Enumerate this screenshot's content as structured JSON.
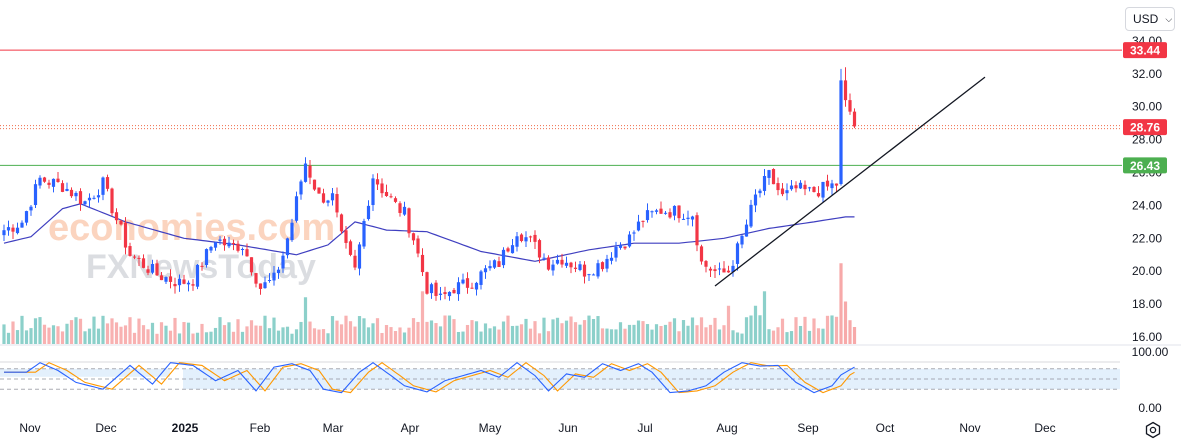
{
  "toolbar": {
    "currency": "USD"
  },
  "colors": {
    "up": "#2962ff",
    "down": "#f23645",
    "ma": "#3f3fc0",
    "resistance": "#f23645",
    "current": "#ef6c4a",
    "support": "#4caf50",
    "stoch_k": "#2962ff",
    "stoch_d": "#ff9800",
    "vol_up": "#80cbc4",
    "vol_down": "#f7a9a9",
    "band": "#e3f0fc"
  },
  "watermark": {
    "line1": "economies.com",
    "line2": "FXNewsToday"
  },
  "chart_data": {
    "type": "candlestick",
    "x_axis": {
      "labels": [
        "Nov",
        "Dec",
        "2025",
        "Feb",
        "Mar",
        "Apr",
        "May",
        "Jun",
        "Jul",
        "Aug",
        "Sep",
        "Oct",
        "Nov",
        "Dec"
      ]
    },
    "y_axis": {
      "ticks": [
        "34.00",
        "32.00",
        "30.00",
        "28.00",
        "26.00",
        "24.00",
        "22.00",
        "20.00",
        "18.00",
        "16.00"
      ],
      "range": [
        15.5,
        34.5
      ]
    },
    "price_levels": [
      {
        "name": "resistance",
        "value": 33.44,
        "label": "33.44",
        "style": "solid"
      },
      {
        "name": "current",
        "value": 28.76,
        "label": "28.76",
        "style": "dotted"
      },
      {
        "name": "support",
        "value": 26.43,
        "label": "26.43",
        "style": "solid"
      }
    ],
    "moving_average_anchors": [
      [
        0,
        21.7
      ],
      [
        6,
        22.1
      ],
      [
        13,
        23.8
      ],
      [
        17,
        24.1
      ],
      [
        27,
        23.0
      ],
      [
        40,
        22.0
      ],
      [
        52,
        21.6
      ],
      [
        65,
        21.0
      ],
      [
        72,
        21.6
      ],
      [
        78,
        23.0
      ],
      [
        85,
        22.5
      ],
      [
        94,
        22.4
      ],
      [
        106,
        21.2
      ],
      [
        118,
        20.6
      ],
      [
        130,
        21.3
      ],
      [
        140,
        21.7
      ],
      [
        150,
        21.7
      ],
      [
        160,
        22.0
      ],
      [
        170,
        22.6
      ],
      [
        180,
        23.0
      ],
      [
        187,
        23.3
      ]
    ],
    "price_anchors": [
      [
        0,
        22.5
      ],
      [
        4,
        23.0
      ],
      [
        8,
        25.6
      ],
      [
        13,
        25.2
      ],
      [
        18,
        24.2
      ],
      [
        22,
        25.3
      ],
      [
        28,
        21.0
      ],
      [
        34,
        19.8
      ],
      [
        39,
        19.3
      ],
      [
        42,
        19.5
      ],
      [
        47,
        22.0
      ],
      [
        50,
        21.5
      ],
      [
        53,
        21.6
      ],
      [
        57,
        19.0
      ],
      [
        60,
        19.5
      ],
      [
        62,
        21.0
      ],
      [
        64,
        23.0
      ],
      [
        66,
        25.5
      ],
      [
        67,
        26.6
      ],
      [
        70,
        24.5
      ],
      [
        73,
        24.5
      ],
      [
        75,
        22.0
      ],
      [
        78,
        20.0
      ],
      [
        80,
        23.0
      ],
      [
        82,
        25.8
      ],
      [
        84,
        25.0
      ],
      [
        87,
        24.0
      ],
      [
        89,
        23.5
      ],
      [
        91,
        22.0
      ],
      [
        94,
        19.0
      ],
      [
        97,
        18.3
      ],
      [
        100,
        19.0
      ],
      [
        103,
        19.2
      ],
      [
        107,
        20.0
      ],
      [
        110,
        20.5
      ],
      [
        114,
        22.5
      ],
      [
        117,
        21.8
      ],
      [
        121,
        20.5
      ],
      [
        124,
        20.8
      ],
      [
        129,
        20.0
      ],
      [
        133,
        20.5
      ],
      [
        136,
        21.5
      ],
      [
        139,
        22.0
      ],
      [
        142,
        23.2
      ],
      [
        146,
        23.7
      ],
      [
        150,
        23.6
      ],
      [
        153,
        23.5
      ],
      [
        155,
        20.5
      ],
      [
        159,
        19.8
      ],
      [
        161,
        20.0
      ],
      [
        164,
        22.0
      ],
      [
        167,
        24.5
      ],
      [
        170,
        25.8
      ],
      [
        173,
        24.5
      ],
      [
        176,
        25.0
      ],
      [
        179,
        24.8
      ],
      [
        182,
        25.0
      ],
      [
        185,
        25.3
      ]
    ],
    "candles_end": [
      {
        "i": 186,
        "o": 25.3,
        "h": 32.3,
        "l": 25.2,
        "c": 31.6
      },
      {
        "i": 187,
        "o": 31.6,
        "h": 32.4,
        "l": 30.0,
        "c": 30.4
      },
      {
        "i": 188,
        "o": 30.4,
        "h": 30.8,
        "l": 29.5,
        "c": 29.7
      },
      {
        "i": 189,
        "o": 29.7,
        "h": 29.9,
        "l": 28.7,
        "c": 28.8
      }
    ],
    "trendline": {
      "from": [
        158,
        19.1
      ],
      "to": [
        218,
        31.8
      ]
    },
    "volume_tall": [
      [
        186,
        0.95
      ],
      [
        187,
        0.5
      ],
      [
        188,
        0.28
      ],
      [
        169,
        0.62
      ],
      [
        167,
        0.45
      ],
      [
        93,
        0.62
      ],
      [
        67,
        0.55
      ],
      [
        161,
        0.45
      ]
    ],
    "stochastic": {
      "range": [
        0,
        100
      ],
      "band": [
        20,
        80
      ],
      "ticks": [
        "100.00",
        "0.00"
      ],
      "k_anchors": [
        [
          0,
          70
        ],
        [
          5,
          70
        ],
        [
          8,
          98
        ],
        [
          12,
          75
        ],
        [
          16,
          40
        ],
        [
          22,
          20
        ],
        [
          28,
          90
        ],
        [
          33,
          35
        ],
        [
          37,
          98
        ],
        [
          42,
          90
        ],
        [
          47,
          45
        ],
        [
          52,
          75
        ],
        [
          56,
          15
        ],
        [
          60,
          85
        ],
        [
          64,
          95
        ],
        [
          68,
          75
        ],
        [
          71,
          20
        ],
        [
          75,
          10
        ],
        [
          79,
          70
        ],
        [
          82,
          98
        ],
        [
          86,
          60
        ],
        [
          89,
          30
        ],
        [
          94,
          12
        ],
        [
          98,
          45
        ],
        [
          102,
          60
        ],
        [
          106,
          75
        ],
        [
          110,
          55
        ],
        [
          114,
          98
        ],
        [
          118,
          60
        ],
        [
          121,
          15
        ],
        [
          125,
          65
        ],
        [
          129,
          55
        ],
        [
          133,
          95
        ],
        [
          137,
          75
        ],
        [
          141,
          95
        ],
        [
          144,
          70
        ],
        [
          148,
          10
        ],
        [
          152,
          15
        ],
        [
          156,
          30
        ],
        [
          160,
          70
        ],
        [
          164,
          98
        ],
        [
          168,
          88
        ],
        [
          172,
          90
        ],
        [
          176,
          40
        ],
        [
          180,
          10
        ],
        [
          184,
          30
        ],
        [
          186,
          62
        ],
        [
          189,
          85
        ]
      ]
    }
  }
}
